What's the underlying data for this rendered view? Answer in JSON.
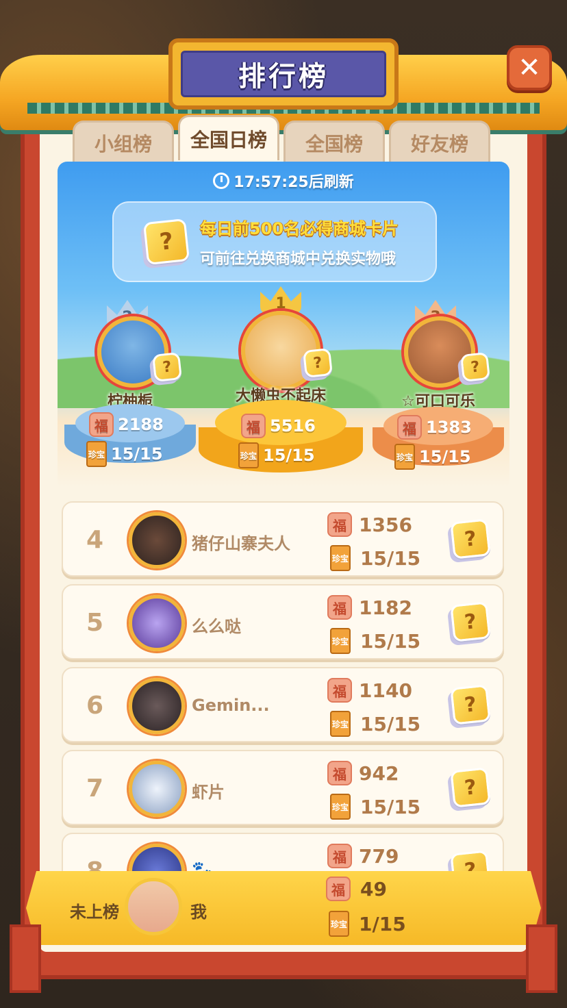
{
  "title": "排行榜",
  "close_label": "✕",
  "tabs": [
    {
      "label": "小组榜",
      "active": false
    },
    {
      "label": "全国日榜",
      "active": true
    },
    {
      "label": "全国榜",
      "active": false
    },
    {
      "label": "好友榜",
      "active": false
    }
  ],
  "refresh_text": "17:57:25后刷新",
  "notice": {
    "line1": "每日前500名必得商城卡片",
    "line2": "可前往兑换商城中兑换实物哦",
    "card_glyph": "?"
  },
  "icons": {
    "fu": "福",
    "book": "珍宝",
    "crown1": "1",
    "crown2": "2",
    "crown3": "3"
  },
  "podium": [
    {
      "rank": 2,
      "name": "柠柚栀",
      "score": "2188",
      "progress": "15/15"
    },
    {
      "rank": 1,
      "name": "大懒虫不起床",
      "score": "5516",
      "progress": "15/15"
    },
    {
      "rank": 3,
      "name": "☆可口可乐",
      "score": "1383",
      "progress": "15/15"
    }
  ],
  "list": [
    {
      "rank": "4",
      "name": "猪仔山寨夫人",
      "score": "1356",
      "progress": "15/15"
    },
    {
      "rank": "5",
      "name": "么么哒",
      "score": "1182",
      "progress": "15/15"
    },
    {
      "rank": "6",
      "name": "Gemin...",
      "score": "1140",
      "progress": "15/15"
    },
    {
      "rank": "7",
      "name": "虾片",
      "score": "942",
      "progress": "15/15"
    },
    {
      "rank": "8",
      "name": "🐾",
      "score": "779",
      "progress": ""
    }
  ],
  "me": {
    "status": "未上榜",
    "name": "我",
    "score": "49",
    "progress": "1/15"
  },
  "colors": {
    "frame": "#c9472f",
    "gold": "#f5a623",
    "title_plaque": "#5a57a8",
    "panel": "#fbf4e4"
  }
}
